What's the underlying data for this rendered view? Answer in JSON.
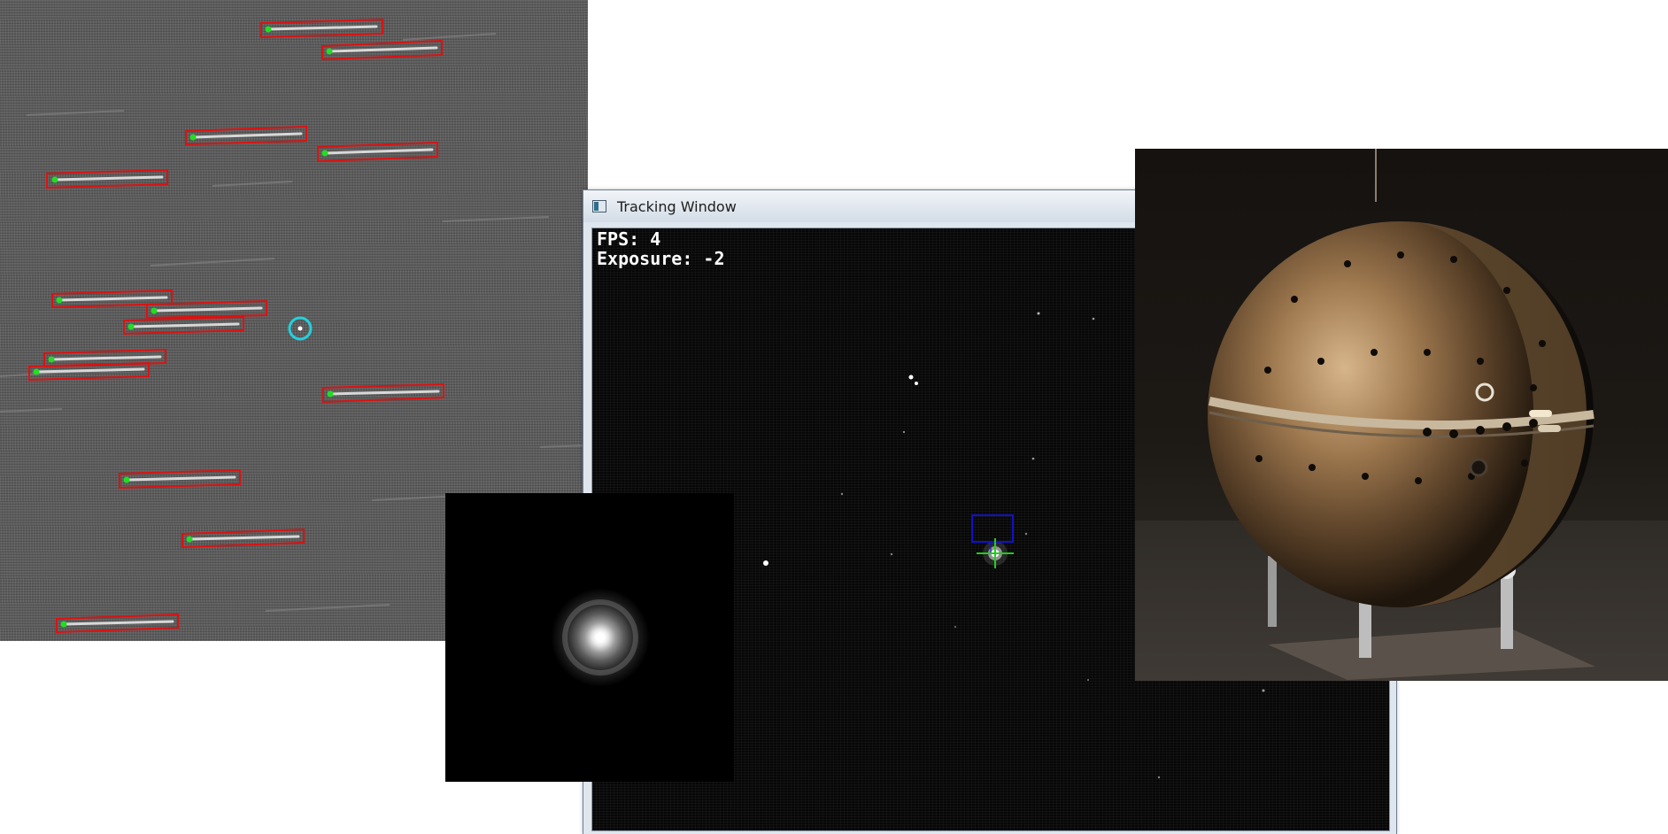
{
  "streak_panel": {
    "description": "",
    "target_marker": "cyan-circle-icon"
  },
  "tracking_window": {
    "title": "Tracking Window",
    "fps_text": "FPS: 4",
    "exposure_text": "Exposure: -2",
    "icon": "window-app-icon"
  },
  "psf_inset": {},
  "sphere_photo": {},
  "colors": {
    "detection_box": "#dd1111",
    "streak_start_dot": "#22dd22",
    "target_circle": "#22d0dd",
    "tracking_box": "#1010cc",
    "crosshair": "#22cc22"
  }
}
